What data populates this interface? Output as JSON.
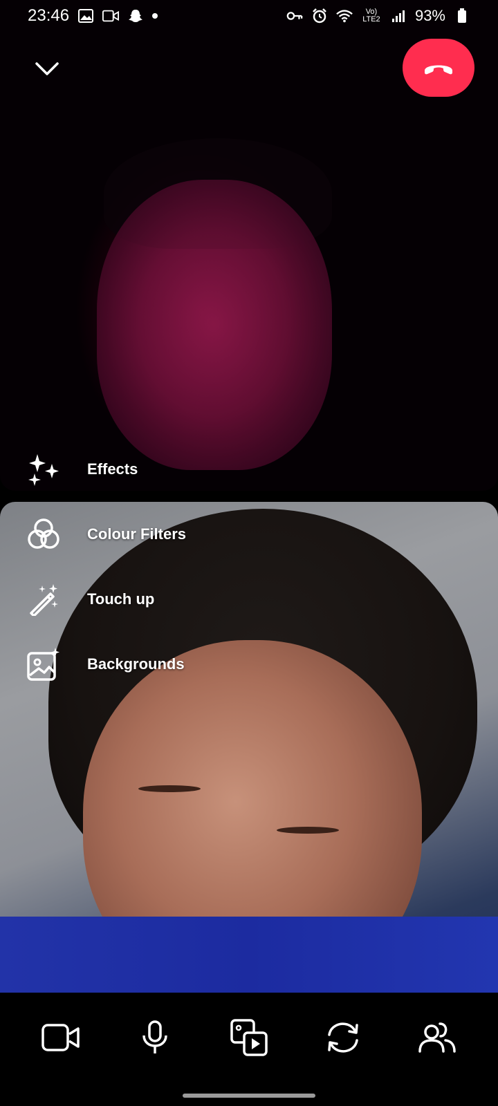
{
  "status_bar": {
    "time": "23:46",
    "network": "Vo) LTE2",
    "battery": "93%"
  },
  "call": {
    "end_call_color": "#ff2d4f"
  },
  "effects_menu": {
    "items": [
      {
        "label": "Effects",
        "icon": "sparkles-icon"
      },
      {
        "label": "Colour Filters",
        "icon": "colour-filters-icon"
      },
      {
        "label": "Touch up",
        "icon": "magic-wand-icon"
      },
      {
        "label": "Backgrounds",
        "icon": "background-image-icon"
      }
    ]
  },
  "bottom_bar": {
    "buttons": [
      {
        "name": "camera-toggle",
        "icon": "video-camera-icon"
      },
      {
        "name": "microphone-toggle",
        "icon": "microphone-icon"
      },
      {
        "name": "share-media",
        "icon": "media-share-icon"
      },
      {
        "name": "flip-camera",
        "icon": "camera-switch-icon"
      },
      {
        "name": "participants",
        "icon": "people-icon"
      }
    ]
  }
}
